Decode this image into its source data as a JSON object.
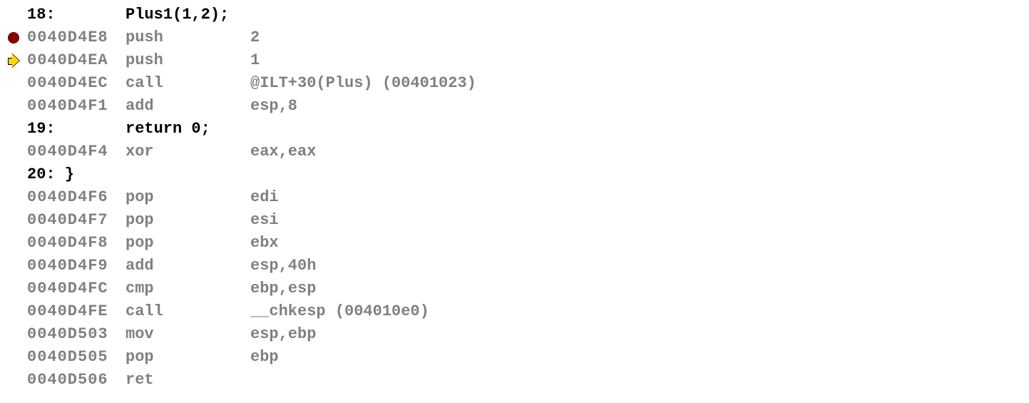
{
  "lines": [
    {
      "type": "source",
      "marker": null,
      "lineno": "18:",
      "code": "Plus1(1,2);"
    },
    {
      "type": "asm",
      "marker": "breakpoint",
      "addr": "0040D4E8",
      "mnemonic": "push",
      "operand": "2"
    },
    {
      "type": "asm",
      "marker": "current",
      "addr": "0040D4EA",
      "mnemonic": "push",
      "operand": "1"
    },
    {
      "type": "asm",
      "marker": null,
      "addr": "0040D4EC",
      "mnemonic": "call",
      "operand": "@ILT+30(Plus) (00401023)"
    },
    {
      "type": "asm",
      "marker": null,
      "addr": "0040D4F1",
      "mnemonic": "add",
      "operand": "esp,8"
    },
    {
      "type": "source",
      "marker": null,
      "lineno": "19:",
      "code": "return 0;"
    },
    {
      "type": "asm",
      "marker": null,
      "addr": "0040D4F4",
      "mnemonic": "xor",
      "operand": "eax,eax"
    },
    {
      "type": "source",
      "marker": null,
      "lineno": "20:   }",
      "code": ""
    },
    {
      "type": "asm",
      "marker": null,
      "addr": "0040D4F6",
      "mnemonic": "pop",
      "operand": "edi"
    },
    {
      "type": "asm",
      "marker": null,
      "addr": "0040D4F7",
      "mnemonic": "pop",
      "operand": "esi"
    },
    {
      "type": "asm",
      "marker": null,
      "addr": "0040D4F8",
      "mnemonic": "pop",
      "operand": "ebx"
    },
    {
      "type": "asm",
      "marker": null,
      "addr": "0040D4F9",
      "mnemonic": "add",
      "operand": "esp,40h"
    },
    {
      "type": "asm",
      "marker": null,
      "addr": "0040D4FC",
      "mnemonic": "cmp",
      "operand": "ebp,esp"
    },
    {
      "type": "asm",
      "marker": null,
      "addr": "0040D4FE",
      "mnemonic": "call",
      "operand": "__chkesp (004010e0)"
    },
    {
      "type": "asm",
      "marker": null,
      "addr": "0040D503",
      "mnemonic": "mov",
      "operand": "esp,ebp"
    },
    {
      "type": "asm",
      "marker": null,
      "addr": "0040D505",
      "mnemonic": "pop",
      "operand": "ebp"
    },
    {
      "type": "asm",
      "marker": null,
      "addr": "0040D506",
      "mnemonic": "ret",
      "operand": ""
    }
  ]
}
